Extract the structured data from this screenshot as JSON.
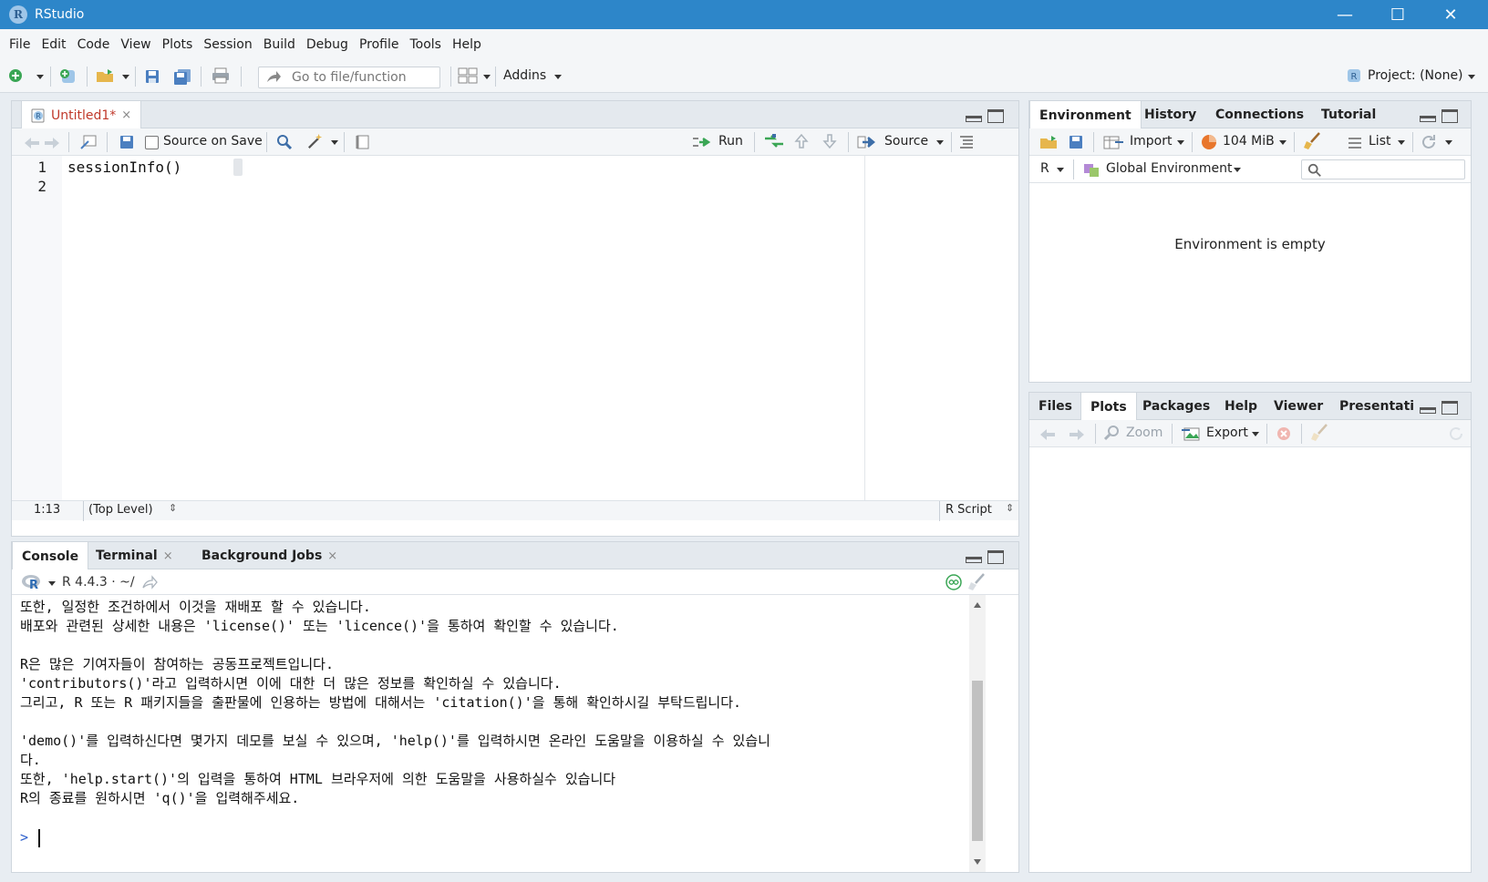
{
  "window": {
    "title": "RStudio",
    "logo_letter": "R",
    "minimize": "—",
    "maximize": "☐",
    "close": "✕"
  },
  "menu": [
    "File",
    "Edit",
    "Code",
    "View",
    "Plots",
    "Session",
    "Build",
    "Debug",
    "Profile",
    "Tools",
    "Help"
  ],
  "toolbar": {
    "goto_placeholder": "Go to file/function",
    "addins_label": "Addins",
    "project_label": "Project: (None)"
  },
  "editor": {
    "tab_label": "Untitled1*",
    "tab_close": "×",
    "source_on_save": "Source on Save",
    "run_label": "Run",
    "source_label": "Source",
    "line_numbers": [
      "1",
      "2"
    ],
    "code_lines": [
      "sessionInfo()",
      ""
    ],
    "status_position": "1:13",
    "status_scope": "(Top Level)",
    "status_type": "R Script"
  },
  "console": {
    "tabs": [
      {
        "label": "Console",
        "closable": false
      },
      {
        "label": "Terminal",
        "closable": true
      },
      {
        "label": "Background Jobs",
        "closable": true
      }
    ],
    "close_glyph": "×",
    "version_label": "R 4.4.3 · ~/",
    "lines": [
      "또한, 일정한 조건하에서 이것을 재배포 할 수 있습니다.",
      "배포와 관련된 상세한 내용은 'license()' 또는 'licence()'을 통하여 확인할 수 있습니다.",
      "",
      "R은 많은 기여자들이 참여하는 공동프로젝트입니다.",
      "'contributors()'라고 입력하시면 이에 대한 더 많은 정보를 확인하실 수 있습니다.",
      "그리고, R 또는 R 패키지들을 출판물에 인용하는 방법에 대해서는 'citation()'을 통해 확인하시길 부탁드립니다.",
      "",
      "'demo()'를 입력하신다면 몇가지 데모를 보실 수 있으며, 'help()'를 입력하시면 온라인 도움말을 이용하실 수 있습니",
      "다.",
      "또한, 'help.start()'의 입력을 통하여 HTML 브라우저에 의한 도움말을 사용하실수 있습니다",
      "R의 종료를 원하시면 'q()'을 입력해주세요."
    ],
    "prompt": ">"
  },
  "environment": {
    "tabs": [
      "Environment",
      "History",
      "Connections",
      "Tutorial"
    ],
    "import_label": "Import",
    "memory_label": "104 MiB",
    "list_label": "List",
    "lang_label": "R",
    "scope_label": "Global Environment",
    "empty_message": "Environment is empty"
  },
  "files": {
    "tabs": [
      "Files",
      "Plots",
      "Packages",
      "Help",
      "Viewer",
      "Presentati"
    ],
    "zoom_label": "Zoom",
    "export_label": "Export"
  },
  "colors": {
    "titlebar": "#2d86c9",
    "accent": "#4b8bd1",
    "green": "#3aa655"
  }
}
